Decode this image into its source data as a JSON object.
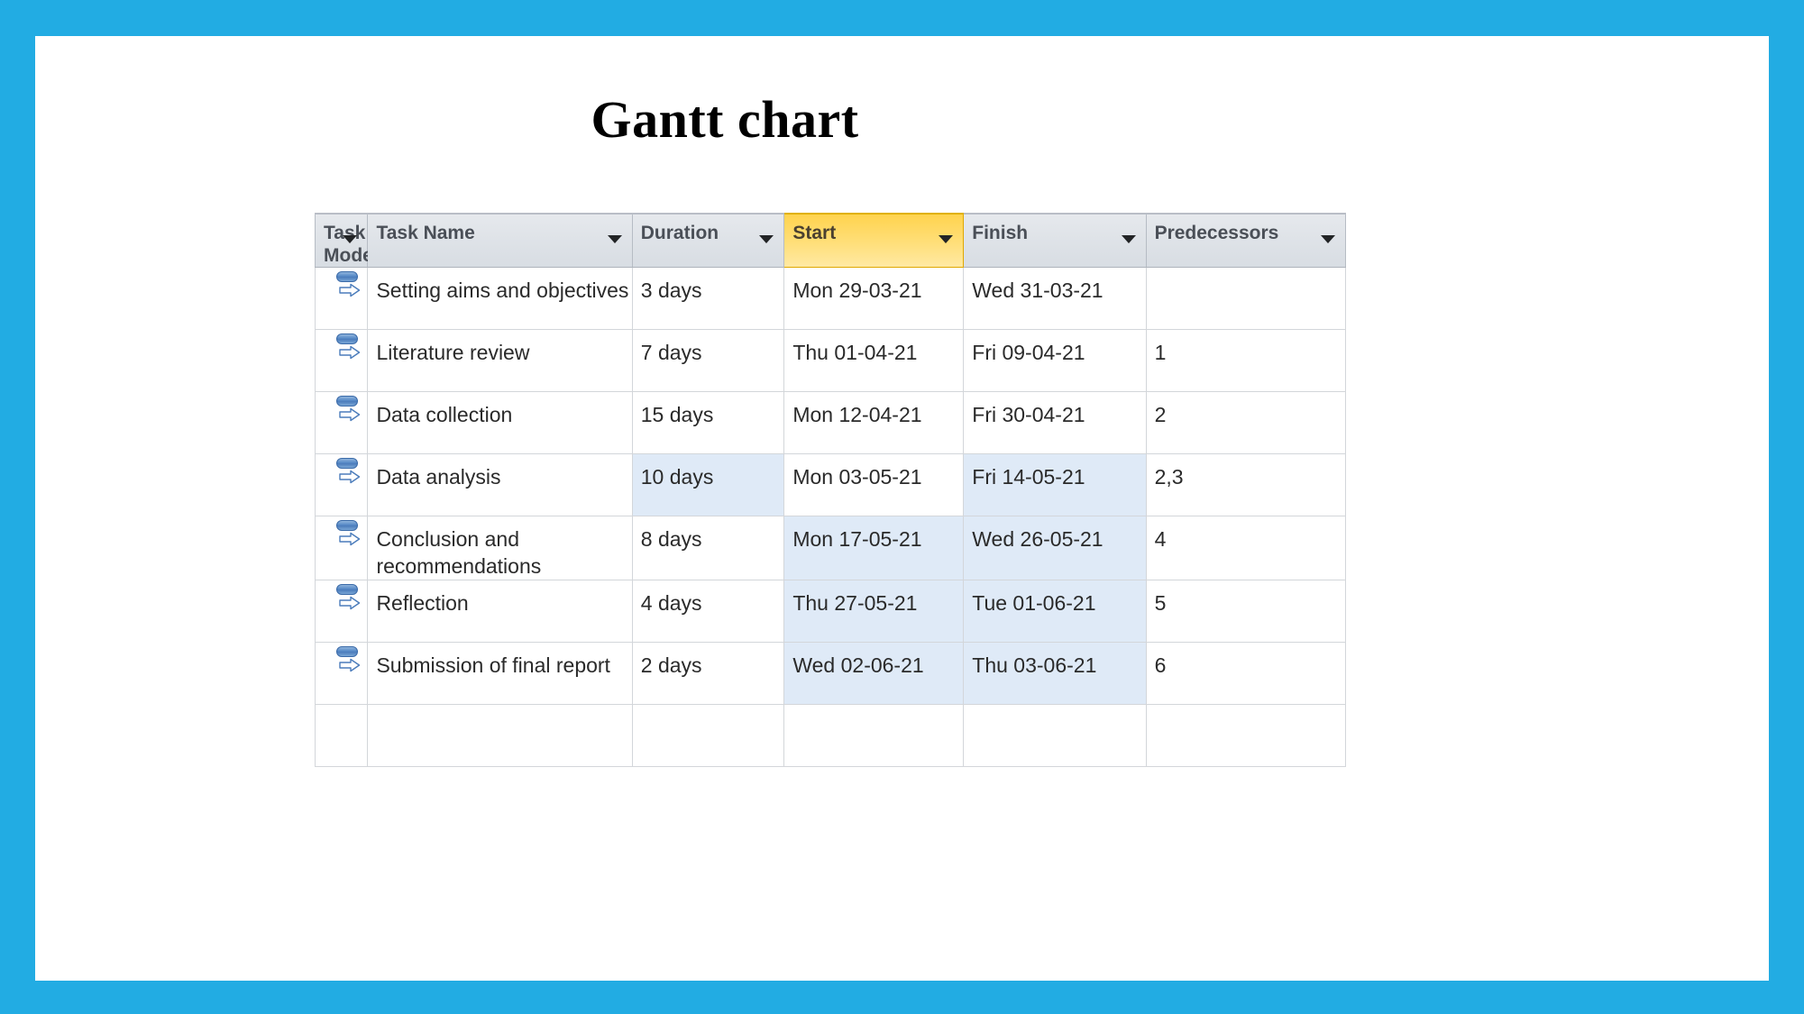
{
  "theme": {
    "border_color": "#22ace3",
    "slide_bg": "#ffffff",
    "header_bg": "#dfe3e8",
    "selected_header_bg": "#ffd34e",
    "shaded_cell_bg": "#dfeaf7",
    "grid_line": "#d3d6da"
  },
  "title": "Gantt chart",
  "table": {
    "columns": [
      {
        "key": "task_mode",
        "label": "Task\nMode",
        "selected": false,
        "has_filter": true
      },
      {
        "key": "task_name",
        "label": "Task Name",
        "selected": false,
        "has_filter": true
      },
      {
        "key": "duration",
        "label": "Duration",
        "selected": false,
        "has_filter": true
      },
      {
        "key": "start",
        "label": "Start",
        "selected": true,
        "has_filter": true
      },
      {
        "key": "finish",
        "label": "Finish",
        "selected": false,
        "has_filter": true
      },
      {
        "key": "predecessors",
        "label": "Predecessors",
        "selected": false,
        "has_filter": true
      }
    ],
    "mode_icon_name": "auto-scheduled-icon",
    "rows": [
      {
        "task_mode": "auto-scheduled-icon",
        "task_name": "Setting aims and objectives",
        "duration": "3 days",
        "start": "Mon 29-03-21",
        "finish": "Wed 31-03-21",
        "predecessors": "",
        "shaded": {
          "duration": false,
          "start": false,
          "finish": false
        }
      },
      {
        "task_mode": "auto-scheduled-icon",
        "task_name": "Literature review",
        "duration": "7 days",
        "start": "Thu 01-04-21",
        "finish": "Fri 09-04-21",
        "predecessors": "1",
        "shaded": {
          "duration": false,
          "start": false,
          "finish": false
        }
      },
      {
        "task_mode": "auto-scheduled-icon",
        "task_name": "Data collection",
        "duration": "15 days",
        "start": "Mon 12-04-21",
        "finish": "Fri 30-04-21",
        "predecessors": "2",
        "shaded": {
          "duration": false,
          "start": false,
          "finish": false
        }
      },
      {
        "task_mode": "auto-scheduled-icon",
        "task_name": "Data analysis",
        "duration": "10 days",
        "start": "Mon 03-05-21",
        "finish": "Fri 14-05-21",
        "predecessors": "2,3",
        "shaded": {
          "duration": true,
          "start": false,
          "finish": true
        }
      },
      {
        "task_mode": "auto-scheduled-icon",
        "task_name": "Conclusion and recommendations",
        "duration": "8 days",
        "start": "Mon 17-05-21",
        "finish": "Wed 26-05-21",
        "predecessors": "4",
        "shaded": {
          "duration": false,
          "start": true,
          "finish": true
        }
      },
      {
        "task_mode": "auto-scheduled-icon",
        "task_name": "Reflection",
        "duration": "4 days",
        "start": "Thu 27-05-21",
        "finish": "Tue 01-06-21",
        "predecessors": "5",
        "shaded": {
          "duration": false,
          "start": true,
          "finish": true
        }
      },
      {
        "task_mode": "auto-scheduled-icon",
        "task_name": "Submission of final report",
        "duration": "2 days",
        "start": "Wed 02-06-21",
        "finish": "Thu 03-06-21",
        "predecessors": "6",
        "shaded": {
          "duration": false,
          "start": true,
          "finish": true
        }
      }
    ]
  },
  "chart_data": {
    "type": "table",
    "title": "Gantt chart",
    "columns": [
      "Task Mode",
      "Task Name",
      "Duration",
      "Start",
      "Finish",
      "Predecessors"
    ],
    "rows": [
      [
        "Auto Scheduled",
        "Setting aims and objectives",
        "3 days",
        "Mon 29-03-21",
        "Wed 31-03-21",
        ""
      ],
      [
        "Auto Scheduled",
        "Literature review",
        "7 days",
        "Thu 01-04-21",
        "Fri 09-04-21",
        "1"
      ],
      [
        "Auto Scheduled",
        "Data collection",
        "15 days",
        "Mon 12-04-21",
        "Fri 30-04-21",
        "2"
      ],
      [
        "Auto Scheduled",
        "Data analysis",
        "10 days",
        "Mon 03-05-21",
        "Fri 14-05-21",
        "2,3"
      ],
      [
        "Auto Scheduled",
        "Conclusion and recommendations",
        "8 days",
        "Mon 17-05-21",
        "Wed 26-05-21",
        "4"
      ],
      [
        "Auto Scheduled",
        "Reflection",
        "4 days",
        "Thu 27-05-21",
        "Tue 01-06-21",
        "5"
      ],
      [
        "Auto Scheduled",
        "Submission of final report",
        "2 days",
        "Wed 02-06-21",
        "Thu 03-06-21",
        "6"
      ]
    ],
    "durations_days": [
      3,
      7,
      15,
      10,
      8,
      4,
      2
    ],
    "start_dates": [
      "2021-03-29",
      "2021-04-01",
      "2021-04-12",
      "2021-05-03",
      "2021-05-17",
      "2021-05-27",
      "2021-06-02"
    ],
    "finish_dates": [
      "2021-03-31",
      "2021-04-09",
      "2021-04-30",
      "2021-05-14",
      "2021-05-26",
      "2021-06-01",
      "2021-06-03"
    ],
    "project_span": [
      "2021-03-29",
      "2021-06-03"
    ]
  }
}
